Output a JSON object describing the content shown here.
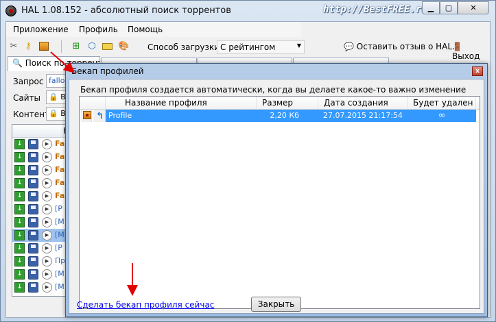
{
  "window": {
    "title": "HAL 1.08.152 - абсолютный поиск торрентов",
    "watermark": "http://BestFREE.ru",
    "min_glyph": "▁",
    "max_glyph": "▢",
    "close_glyph": "✕"
  },
  "menu": {
    "items": [
      "Приложение",
      "Профиль",
      "Помощь"
    ]
  },
  "toolbar": {
    "download_mode_label": "Способ загрузки",
    "download_mode_value": "С рейтингом",
    "feedback_label": "Оставить отзыв о HAL...",
    "exit_label": "Выход"
  },
  "tabs": [
    {
      "label": "Поиск по торрентам"
    }
  ],
  "search": {
    "query_label": "Запрос",
    "query_value": "fallout",
    "sites_label": "Сайты",
    "content_label": "Контент",
    "list_column_head": "Н"
  },
  "results": {
    "rows": [
      "Fa",
      "Fa",
      "Fa",
      "Fa",
      "Fa",
      "[Р",
      "[М",
      "[М",
      "[Р",
      "Пр",
      "[М",
      "[М"
    ],
    "selected_index": 7
  },
  "dialog": {
    "title": "Бекап профилей",
    "close_glyph": "x",
    "description": "Бекап профиля создается автоматически, когда вы делаете какое-то важно изменение настроек",
    "columns": [
      "Название профиля",
      "Размер",
      "Дата создания",
      "Будет удален"
    ],
    "rows": [
      {
        "name": "Profile",
        "size": "2,20 Кб",
        "created": "27.07.2015 21:17:54",
        "delete": "∞"
      }
    ],
    "backup_link": "Сделать бекап профиля сейчас",
    "close_button": "Закрыть"
  },
  "colors": {
    "selection": "#3399ff",
    "arrow": "#e00000",
    "link": "#0000ee"
  }
}
